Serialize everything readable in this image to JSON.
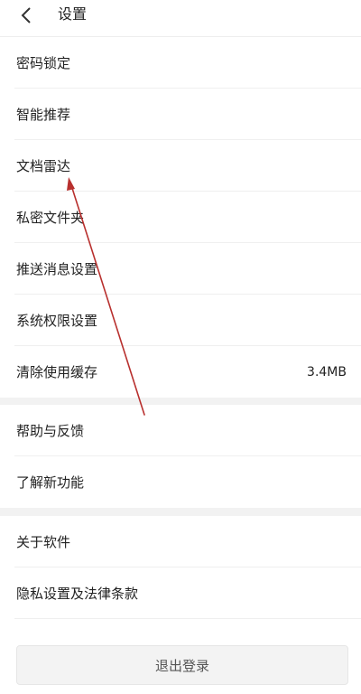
{
  "header": {
    "back_icon": "chevron-left-icon",
    "title": "设置"
  },
  "group1": {
    "items": [
      {
        "label": "密码锁定"
      },
      {
        "label": "智能推荐"
      },
      {
        "label": "文档雷达"
      },
      {
        "label": "私密文件夹"
      },
      {
        "label": "推送消息设置"
      },
      {
        "label": "系统权限设置"
      },
      {
        "label": "清除使用缓存",
        "value": "3.4MB"
      }
    ]
  },
  "group2": {
    "items": [
      {
        "label": "帮助与反馈"
      },
      {
        "label": "了解新功能"
      }
    ]
  },
  "group3": {
    "items": [
      {
        "label": "关于软件"
      },
      {
        "label": "隐私设置及法律条款"
      }
    ]
  },
  "footer": {
    "logout_label": "退出登录"
  },
  "colors": {
    "annotation_arrow": "#b8302e",
    "section_gap": "#f2f2f2"
  }
}
